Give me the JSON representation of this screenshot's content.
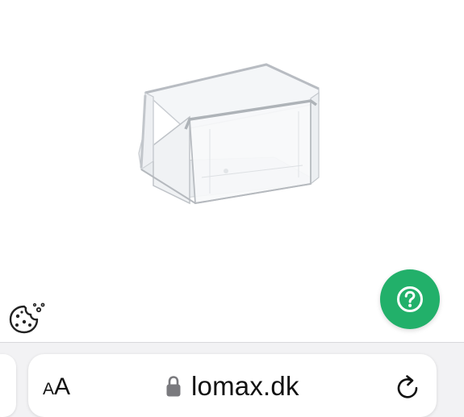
{
  "page": {
    "product_image": "clear-plastic-storage-bin"
  },
  "widgets": {
    "cookie_icon": "cookie-icon",
    "help_icon": "question-mark-icon",
    "help_button_color": "#22b06a"
  },
  "browser": {
    "text_size_small": "A",
    "text_size_large": "A",
    "lock_icon": "lock-icon",
    "url": "lomax.dk",
    "reload_icon": "reload-icon"
  }
}
